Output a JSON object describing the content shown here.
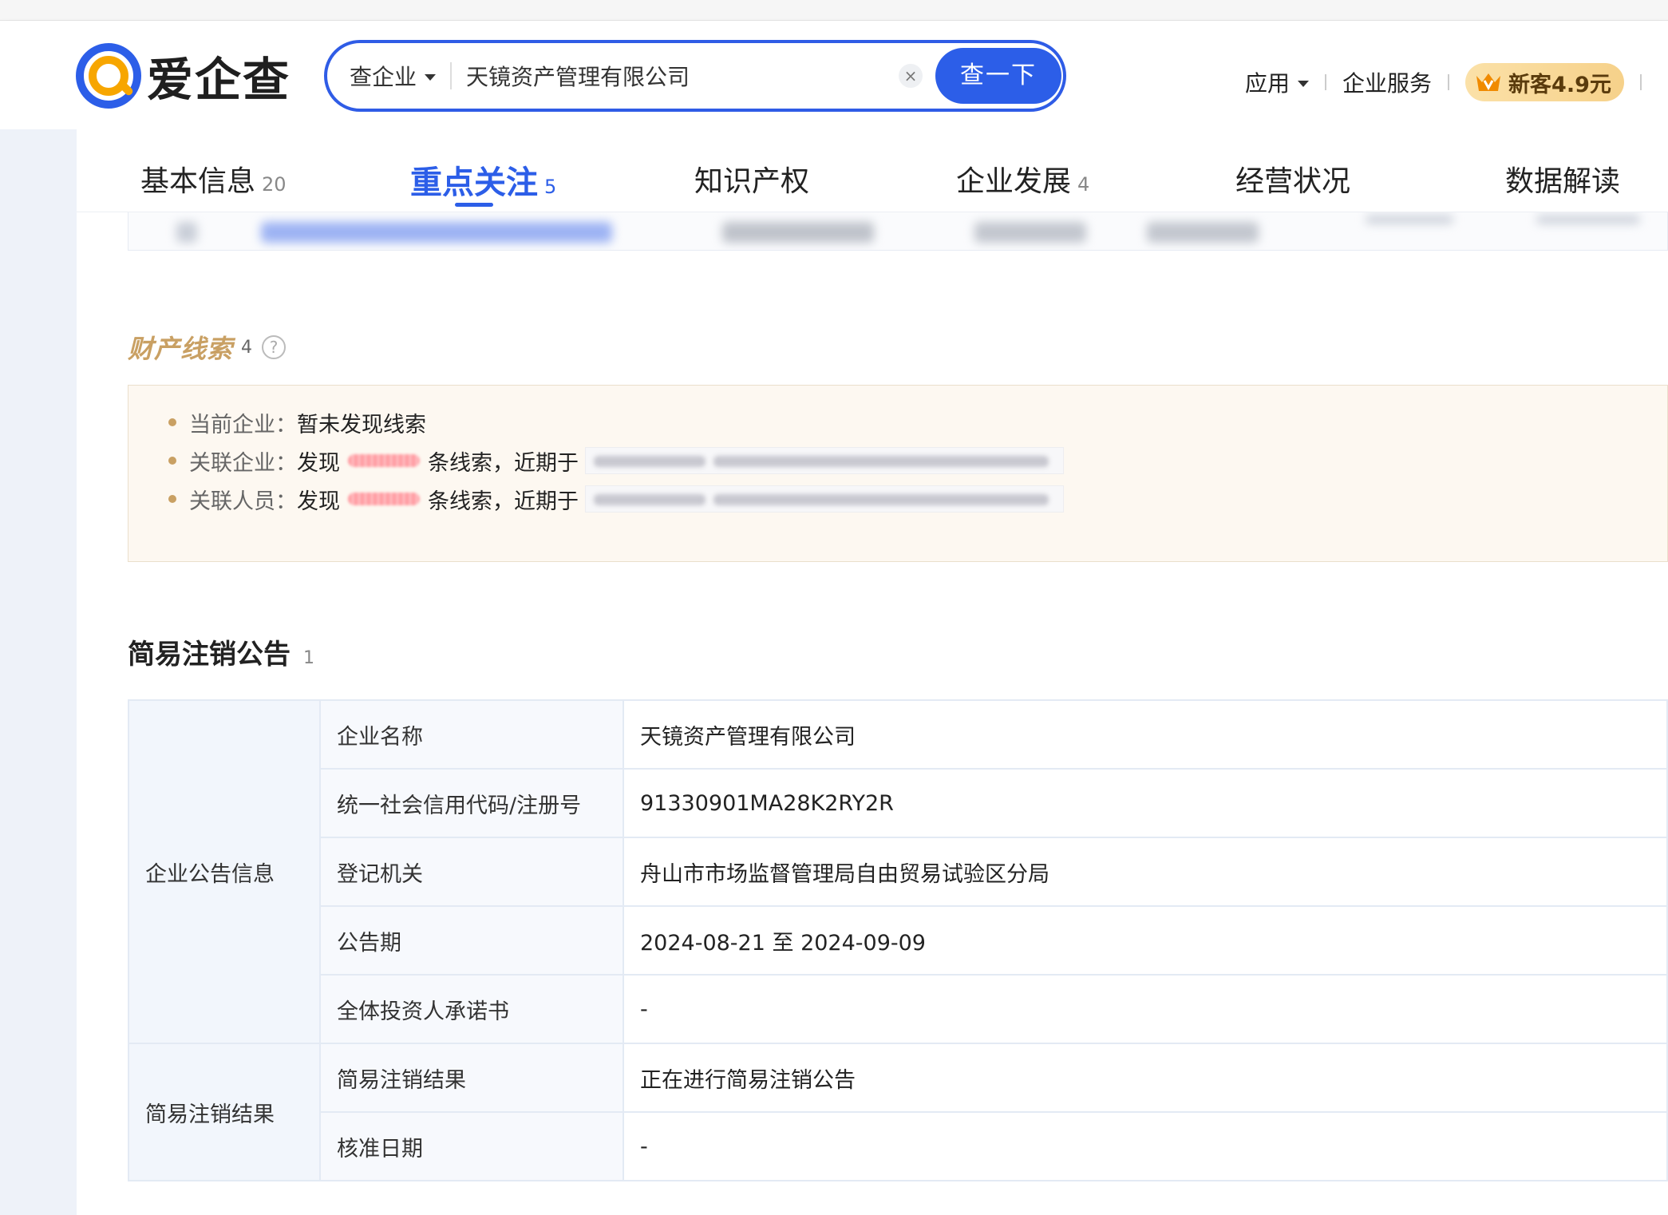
{
  "logo": {
    "text": "爱企查"
  },
  "search": {
    "type_label": "查企业",
    "value": "天镜资产管理有限公司",
    "clear": "×",
    "button_label": "查一下"
  },
  "nav": {
    "apps_label": "应用",
    "services_label": "企业服务",
    "vip_label": "新客4.9元"
  },
  "tabs": [
    {
      "label": "基本信息",
      "count": "20"
    },
    {
      "label": "重点关注",
      "count": "5",
      "active": true
    },
    {
      "label": "知识产权",
      "count": ""
    },
    {
      "label": "企业发展",
      "count": "4"
    },
    {
      "label": "经营状况",
      "count": ""
    },
    {
      "label": "数据解读",
      "count": ""
    }
  ],
  "asset_clues": {
    "title": "财产线索",
    "count": "4",
    "help": "?",
    "lines": [
      {
        "label": "当前企业：",
        "value": "暂未发现线索"
      },
      {
        "label": "关联企业：",
        "prefix": "发现",
        "suffix": "条线索，近期于"
      },
      {
        "label": "关联人员：",
        "prefix": "发现",
        "suffix": "条线索，近期于"
      }
    ]
  },
  "simple_cancellation": {
    "title": "简易注销公告",
    "count": "1",
    "groups": [
      {
        "name": "企业公告信息",
        "rows": [
          {
            "field": "企业名称",
            "value": "天镜资产管理有限公司"
          },
          {
            "field": "统一社会信用代码/注册号",
            "value": "91330901MA28K2RY2R"
          },
          {
            "field": "登记机关",
            "value": "舟山市市场监督管理局自由贸易试验区分局"
          },
          {
            "field": "公告期",
            "value": "2024-08-21 至 2024-09-09"
          },
          {
            "field": "全体投资人承诺书",
            "value": "-"
          }
        ]
      },
      {
        "name": "简易注销结果",
        "rows": [
          {
            "field": "简易注销结果",
            "value": "正在进行简易注销公告"
          },
          {
            "field": "核准日期",
            "value": "-"
          }
        ]
      }
    ]
  },
  "colors": {
    "brand_blue": "#2c5ee8",
    "gold": "#c9a063",
    "logo_orange": "#f7a600"
  }
}
